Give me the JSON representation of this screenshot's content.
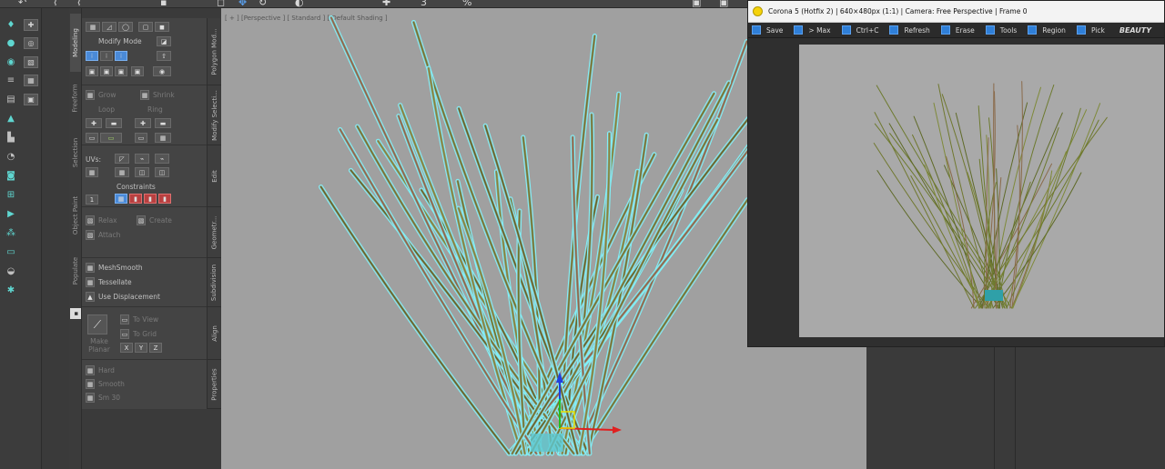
{
  "ribbon": {
    "modify_mode": "Modify Mode",
    "grow": "Grow",
    "shrink": "Shrink",
    "loop": "Loop",
    "ring": "Ring",
    "uvs": "UVs:",
    "constraints": "Constraints",
    "relax": "Relax",
    "create": "Create",
    "attach": "Attach",
    "meshsmooth": "MeshSmooth",
    "tessellate": "Tessellate",
    "use_displacement": "Use Displacement",
    "make_planar": "Make Planar",
    "to_view": "To View",
    "to_grid": "To Grid",
    "x": "X",
    "y": "Y",
    "z": "Z",
    "hard": "Hard",
    "smooth": "Smooth",
    "sm30": "Sm 30"
  },
  "vertical_tabs": [
    "Modeling",
    "Freeform",
    "Selection",
    "Object Paint",
    "Populate"
  ],
  "section_headers": [
    "Polygon Mod...",
    "Modify Selecti...",
    "Edit",
    "Geometr...",
    "Subdivision",
    "Align",
    "Properties"
  ],
  "viewport": {
    "label": "[ + ] [Perspective ] [ Standard ] [ Default Shading ]"
  },
  "render_window": {
    "title": "Corona 5 (Hotfix 2) | 640×480px (1:1) | Camera: Free Perspective | Frame 0",
    "toolbar": [
      "Save",
      "> Max",
      "Ctrl+C",
      "Refresh",
      "Erase",
      "Tools",
      "Region",
      "Pick"
    ],
    "channel": "BEAUTY"
  },
  "colors": {
    "viewport_bg": "#a0a0a0",
    "selection_outline": "#6ff0f8",
    "render_bg": "#a9a9a9",
    "accent_blue": "#2f7fd8"
  }
}
